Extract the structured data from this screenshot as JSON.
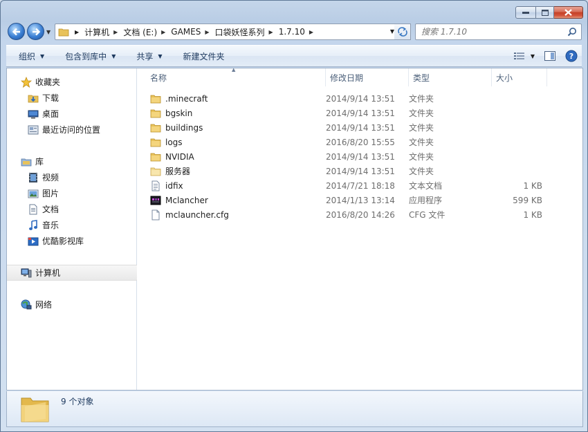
{
  "address": {
    "crumbs": [
      "计算机",
      "文档 (E:)",
      "GAMES",
      "口袋妖怪系列",
      "1.7.10"
    ]
  },
  "search": {
    "placeholder": "搜索 1.7.10"
  },
  "toolbar": {
    "organize": "组织",
    "include_in_library": "包含到库中",
    "share": "共享",
    "new_folder": "新建文件夹"
  },
  "nav": {
    "favorites": {
      "label": "收藏夹",
      "items": [
        "下载",
        "桌面",
        "最近访问的位置"
      ]
    },
    "libraries": {
      "label": "库",
      "items": [
        "视频",
        "图片",
        "文档",
        "音乐",
        "优酷影视库"
      ]
    },
    "computer": "计算机",
    "network": "网络"
  },
  "columns": {
    "name": "名称",
    "date": "修改日期",
    "type": "类型",
    "size": "大小"
  },
  "files": [
    {
      "name": ".minecraft",
      "date": "2014/9/14 13:51",
      "type": "文件夹",
      "size": "",
      "icon": "folder"
    },
    {
      "name": "bgskin",
      "date": "2014/9/14 13:51",
      "type": "文件夹",
      "size": "",
      "icon": "folder"
    },
    {
      "name": "buildings",
      "date": "2014/9/14 13:51",
      "type": "文件夹",
      "size": "",
      "icon": "folder"
    },
    {
      "name": "logs",
      "date": "2016/8/20 15:55",
      "type": "文件夹",
      "size": "",
      "icon": "folder"
    },
    {
      "name": "NVIDIA",
      "date": "2014/9/14 13:51",
      "type": "文件夹",
      "size": "",
      "icon": "folder"
    },
    {
      "name": "服务器",
      "date": "2014/9/14 13:51",
      "type": "文件夹",
      "size": "",
      "icon": "folder-empty"
    },
    {
      "name": "idfix",
      "date": "2014/7/21 18:18",
      "type": "文本文档",
      "size": "1 KB",
      "icon": "text-file"
    },
    {
      "name": "Mclancher",
      "date": "2014/1/13 13:14",
      "type": "应用程序",
      "size": "599 KB",
      "icon": "app"
    },
    {
      "name": "mclauncher.cfg",
      "date": "2016/8/20 14:26",
      "type": "CFG 文件",
      "size": "1 KB",
      "icon": "blank-file"
    }
  ],
  "status": {
    "count": "9 个对象"
  },
  "colors": {
    "accent": "#3b7fd3",
    "folder": "#e8c25a",
    "close": "#c43f25"
  }
}
